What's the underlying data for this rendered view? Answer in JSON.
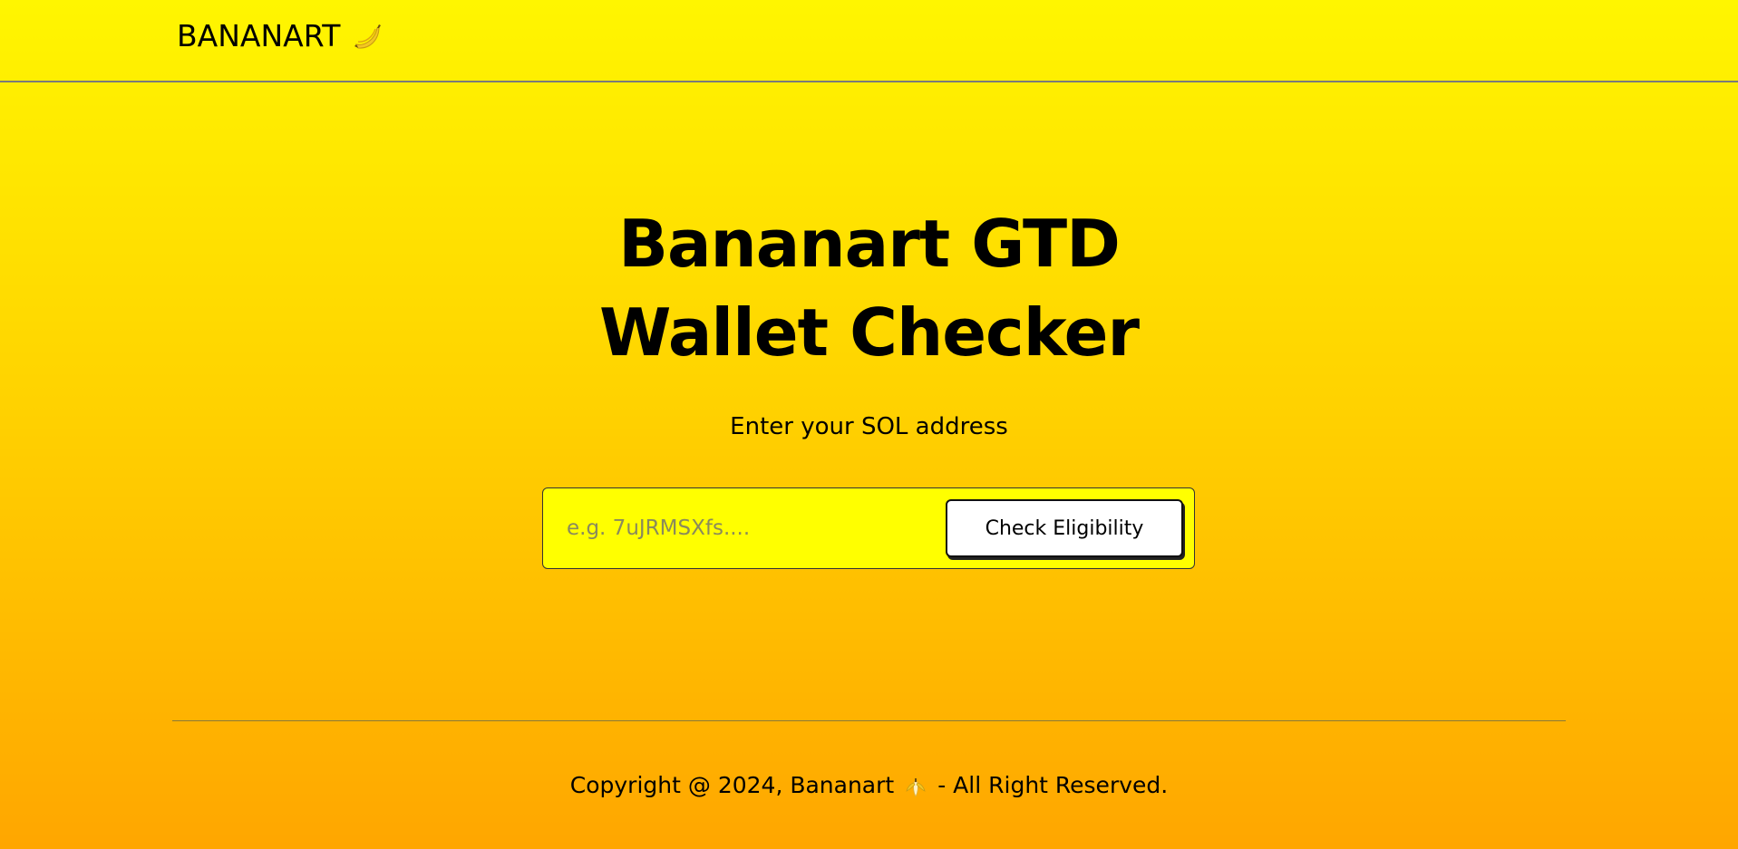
{
  "header": {
    "brand_name": "BANANART",
    "brand_icon": "banana-icon"
  },
  "hero": {
    "title_line1": "Bananart GTD",
    "title_line2": "Wallet Checker",
    "subtitle": "Enter your SOL address"
  },
  "form": {
    "address_placeholder": "e.g. 7uJRMSXfs....",
    "address_value": "",
    "check_button_label": "Check Eligibility"
  },
  "footer": {
    "copyright_prefix": "Copyright @ 2024, Bananart",
    "copyright_icon": "peeled-banana-icon",
    "copyright_suffix": "- All Right Reserved."
  },
  "colors": {
    "gradient_top": "#fff600",
    "gradient_bottom": "#ffa600",
    "input_background": "#ffff00",
    "button_background": "#ffffff"
  }
}
